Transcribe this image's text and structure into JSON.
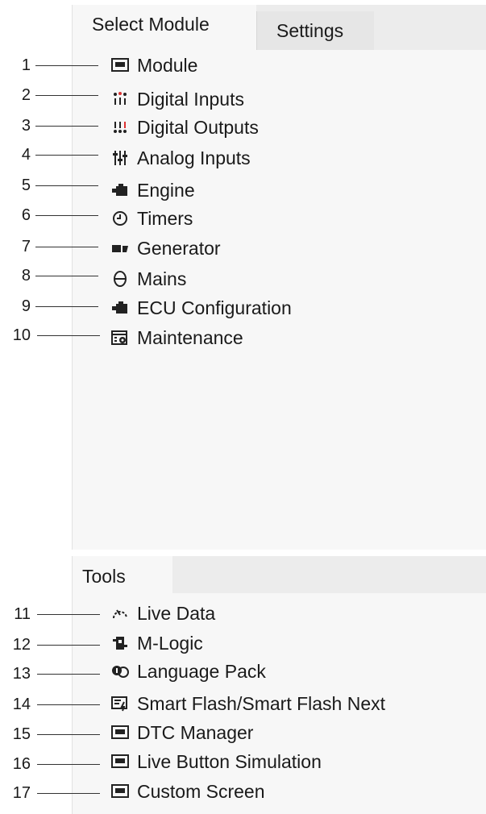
{
  "tabs": {
    "select_module": "Select Module",
    "settings": "Settings",
    "tools": "Tools"
  },
  "select_module_items": [
    {
      "num": "1",
      "label": "Module",
      "icon": "module-icon"
    },
    {
      "num": "2",
      "label": "Digital Inputs",
      "icon": "digital-inputs-icon"
    },
    {
      "num": "3",
      "label": "Digital Outputs",
      "icon": "digital-outputs-icon"
    },
    {
      "num": "4",
      "label": "Analog Inputs",
      "icon": "analog-inputs-icon"
    },
    {
      "num": "5",
      "label": "Engine",
      "icon": "engine-icon"
    },
    {
      "num": "6",
      "label": "Timers",
      "icon": "timer-icon"
    },
    {
      "num": "7",
      "label": "Generator",
      "icon": "generator-icon"
    },
    {
      "num": "8",
      "label": "Mains",
      "icon": "mains-icon"
    },
    {
      "num": "9",
      "label": "ECU Configuration",
      "icon": "ecu-icon"
    },
    {
      "num": "10",
      "label": "Maintenance",
      "icon": "maintenance-icon"
    }
  ],
  "tools_items": [
    {
      "num": "11",
      "label": "Live Data",
      "icon": "live-data-icon"
    },
    {
      "num": "12",
      "label": "M-Logic",
      "icon": "m-logic-icon"
    },
    {
      "num": "13",
      "label": "Language Pack",
      "icon": "language-pack-icon"
    },
    {
      "num": "14",
      "label": "Smart Flash/Smart Flash Next",
      "icon": "smart-flash-icon"
    },
    {
      "num": "15",
      "label": "DTC Manager",
      "icon": "monitor-icon"
    },
    {
      "num": "16",
      "label": "Live Button Simulation",
      "icon": "monitor-icon"
    },
    {
      "num": "17",
      "label": "Custom Screen",
      "icon": "monitor-icon"
    }
  ]
}
